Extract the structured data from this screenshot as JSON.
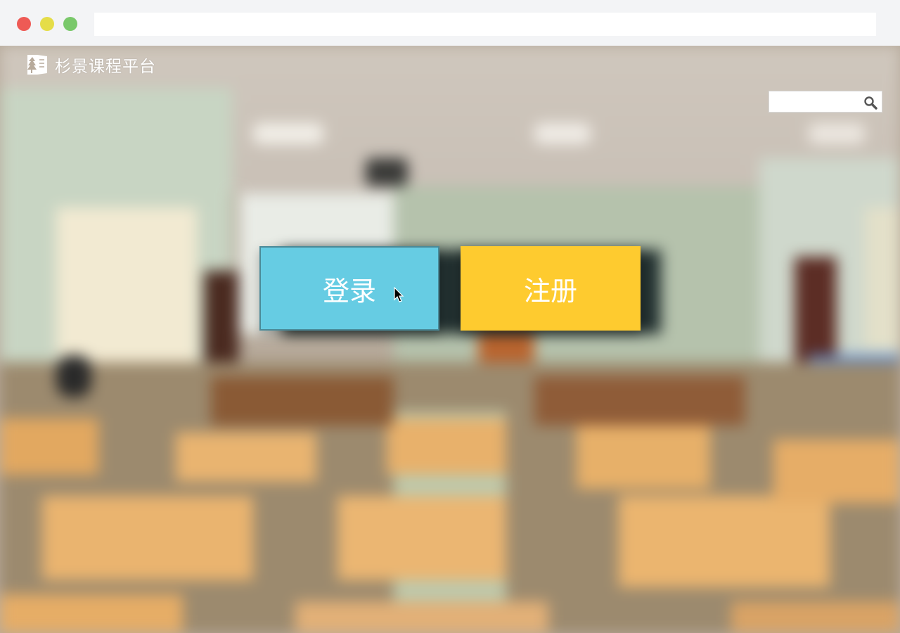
{
  "browser": {
    "url": ""
  },
  "header": {
    "brand_name": "杉景课程平台",
    "logo_icon": "tree-book-icon"
  },
  "search": {
    "value": "",
    "placeholder": "",
    "icon": "search-icon"
  },
  "actions": {
    "login_label": "登录",
    "register_label": "注册"
  },
  "colors": {
    "login": "#66cce3",
    "register": "#fecb2f",
    "chrome": "#f3f4f6"
  }
}
